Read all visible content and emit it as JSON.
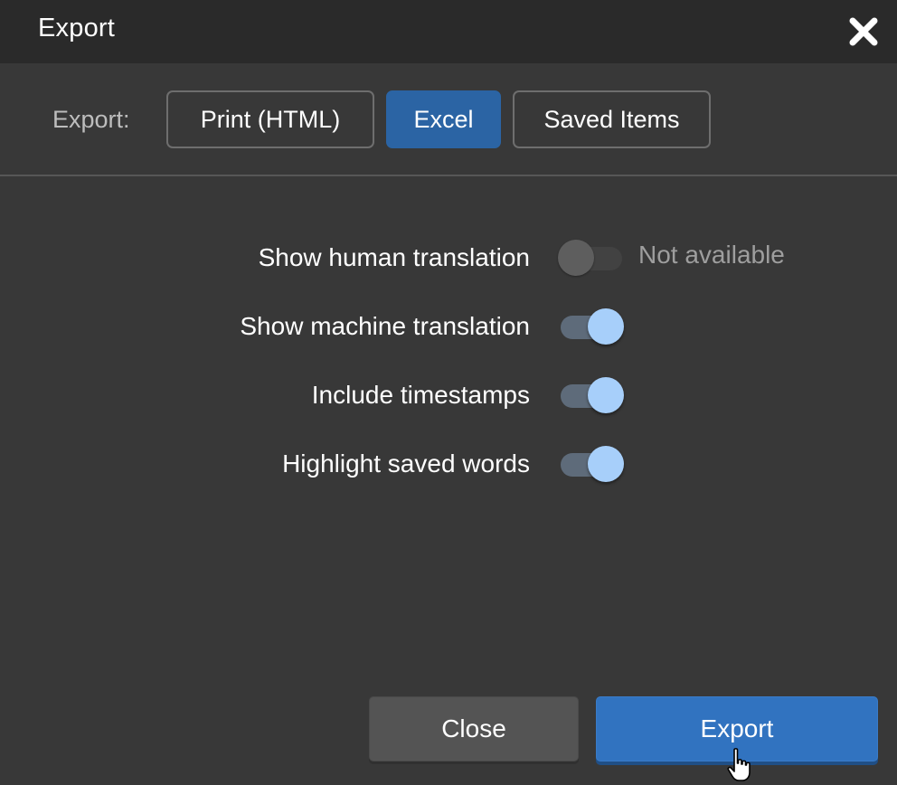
{
  "dialog": {
    "title": "Export",
    "close_icon": "close-icon"
  },
  "export_format": {
    "label": "Export:",
    "options": [
      {
        "label": "Print (HTML)",
        "selected": false
      },
      {
        "label": "Excel",
        "selected": true
      },
      {
        "label": "Saved Items",
        "selected": false
      }
    ]
  },
  "options": [
    {
      "label": "Show human translation",
      "enabled": false,
      "available": false,
      "note": "Not available"
    },
    {
      "label": "Show machine translation",
      "enabled": true,
      "available": true
    },
    {
      "label": "Include timestamps",
      "enabled": true,
      "available": true
    },
    {
      "label": "Highlight saved words",
      "enabled": true,
      "available": true
    }
  ],
  "footer": {
    "close_label": "Close",
    "export_label": "Export"
  },
  "colors": {
    "accent": "#3173c0",
    "selected_tab": "#2b64a4",
    "toggle_knob_on": "#a7cffa",
    "background": "#383838",
    "titlebar": "#2a2a2a"
  }
}
